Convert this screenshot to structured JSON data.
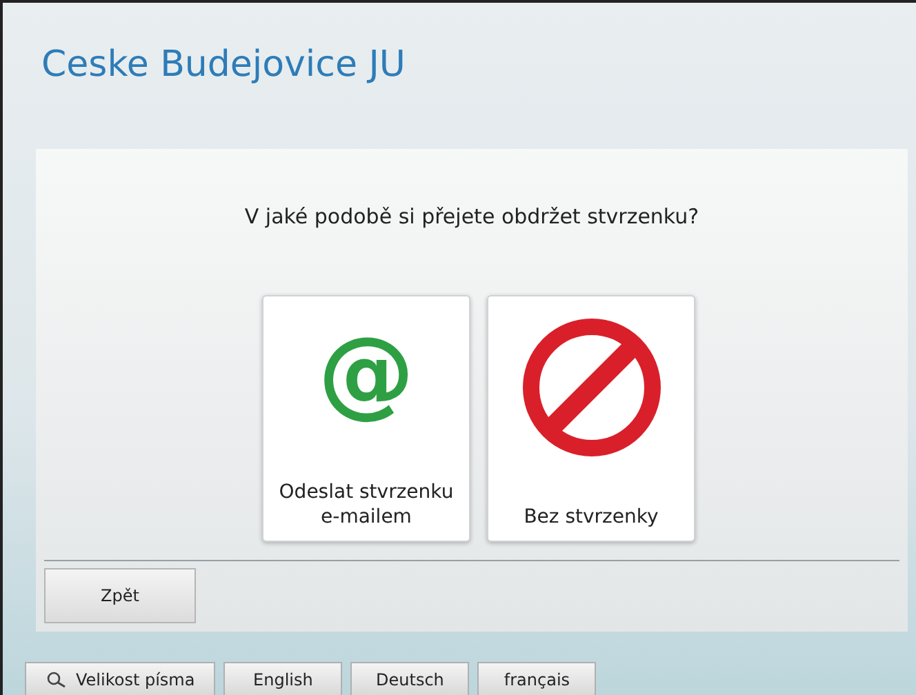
{
  "header": {
    "title": "Ceske Budejovice JU"
  },
  "prompt": "V jaké podobě si přejete obdržet stvrzenku?",
  "options": [
    {
      "kind": "email",
      "symbol": "@",
      "label": "Odeslat stvrzenku e-mailem"
    },
    {
      "kind": "none",
      "label": "Bez stvrzenky"
    }
  ],
  "back_button": "Zpět",
  "footer": [
    {
      "kind": "font-size",
      "label": "Velikost písma"
    },
    {
      "kind": "language",
      "label": "English"
    },
    {
      "kind": "language",
      "label": "Deutsch"
    },
    {
      "kind": "language",
      "label": "français"
    }
  ]
}
